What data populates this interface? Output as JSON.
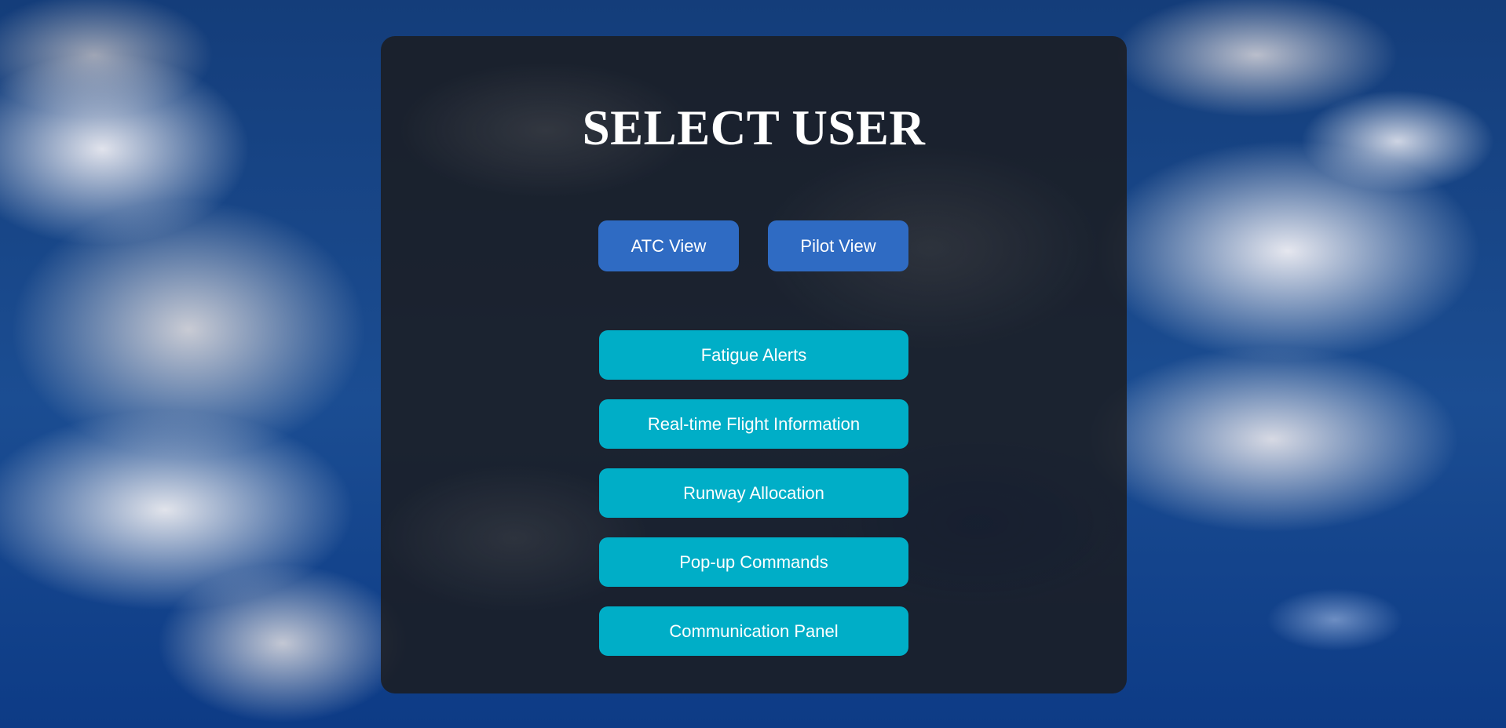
{
  "page": {
    "title": "SELECT USER"
  },
  "views": {
    "atc_label": "ATC View",
    "pilot_label": "Pilot View"
  },
  "features": [
    {
      "label": "Fatigue Alerts"
    },
    {
      "label": "Real-time Flight Information"
    },
    {
      "label": "Runway Allocation"
    },
    {
      "label": "Pop-up Commands"
    },
    {
      "label": "Communication Panel"
    }
  ],
  "colors": {
    "view_button": "#2f6bc3",
    "feature_button": "#00aec7",
    "panel": "#1c1c1e"
  }
}
